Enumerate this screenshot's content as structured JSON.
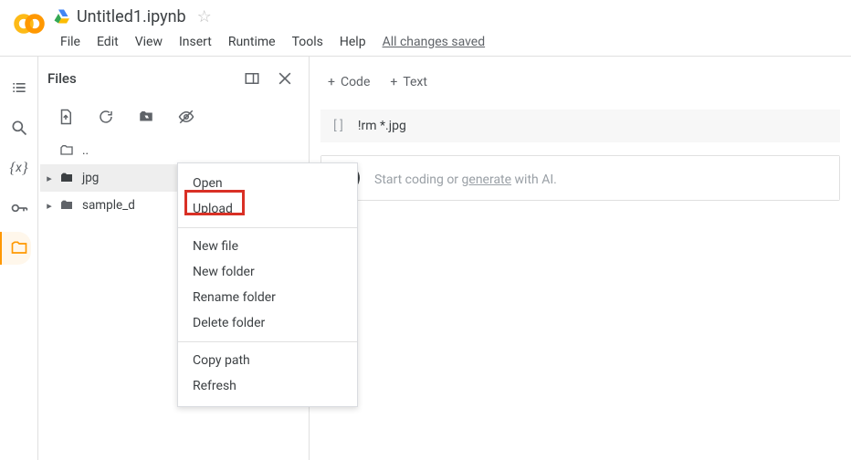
{
  "header": {
    "title": "Untitled1.ipynb",
    "menus": [
      "File",
      "Edit",
      "View",
      "Insert",
      "Runtime",
      "Tools",
      "Help"
    ],
    "changes": "All changes saved"
  },
  "files_panel": {
    "title": "Files",
    "tree": {
      "up_label": "..",
      "jpg_label": "jpg",
      "sample_label": "sample_d"
    }
  },
  "context_menu": {
    "open": "Open",
    "upload": "Upload",
    "new_file": "New file",
    "new_folder": "New folder",
    "rename": "Rename folder",
    "delete": "Delete folder",
    "copy_path": "Copy path",
    "refresh": "Refresh"
  },
  "editor": {
    "add_code": "Code",
    "add_text": "Text",
    "cell1_code": "!rm *.jpg",
    "placeholder_pre": "Start coding or ",
    "placeholder_link": "generate",
    "placeholder_post": " with AI."
  }
}
